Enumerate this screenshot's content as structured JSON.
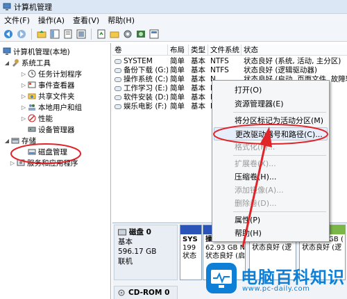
{
  "window": {
    "title": "计算机管理"
  },
  "menu": [
    "文件(F)",
    "操作(A)",
    "查看(V)",
    "帮助(H)"
  ],
  "toolbar": {
    "icons": [
      "back-arrow-icon",
      "forward-arrow-icon",
      "up-folder-icon",
      "show-tree-icon",
      "help-icon",
      "properties-icon",
      "refresh-icon",
      "open-folder-icon",
      "help-book-icon",
      "zoom-icon",
      "settings-icon"
    ]
  },
  "tree": {
    "root": "计算机管理(本地)",
    "system_tools": "系统工具",
    "task_scheduler": "任务计划程序",
    "event_viewer": "事件查看器",
    "shared_folders": "共享文件夹",
    "local_users": "本地用户和组",
    "performance": "性能",
    "device_manager": "设备管理器",
    "storage": "存储",
    "disk_management": "磁盘管理",
    "services_apps": "服务和应用程序"
  },
  "list": {
    "headers": [
      "卷",
      "布局",
      "类型",
      "文件系统",
      "状态"
    ],
    "rows": [
      [
        "SYSTEM",
        "简单",
        "基本",
        "NTFS",
        "状态良好 (系统, 活动, 主分区)"
      ],
      [
        "备份下载 (G:)",
        "简单",
        "基本",
        "NTFS",
        "状态良好 (逻辑驱动器)"
      ],
      [
        "操作系统 (C:)",
        "简单",
        "基本",
        "N",
        "状态良好 (启动, 页面文件, 故障转储"
      ],
      [
        "工作学习 (E:)",
        "简单",
        "基本",
        "N",
        ""
      ],
      [
        "软件安装 (D:)",
        "简单",
        "基本",
        "N",
        ""
      ],
      [
        "娱乐电影 (F:)",
        "简单",
        "基本",
        "N",
        ""
      ]
    ]
  },
  "context_menu": {
    "open": "打开(O)",
    "explorer": "资源管理器(E)",
    "mark_active": "将分区标记为活动分区(M)",
    "change_letter": "更改驱动器号和路径(C)...",
    "format": "格式化(F)...",
    "extend": "扩展卷(X)...",
    "shrink": "压缩卷(H)...",
    "mirror": "添加镜像(A)...",
    "delete": "删除卷(D)...",
    "properties": "属性(P)",
    "help": "帮助(H)"
  },
  "disk0": {
    "name": "磁盘 0",
    "type": "基本",
    "size": "596.17 GB",
    "status": "联机",
    "partitions": [
      {
        "name": "SYS",
        "size": "199",
        "status": "状态"
      },
      {
        "name": "操作系",
        "size": "62.93 GB N",
        "status": "状态良好 (启"
      },
      {
        "name": "",
        "size": "120.00 GB (",
        "status": "状态良好 (逻"
      },
      {
        "name": "",
        "size": "200.00 GB (",
        "status": "状态良好 (逻"
      }
    ]
  },
  "cdrom": {
    "name": "CD-ROM 0"
  },
  "watermark": {
    "text": "电脑百科知识",
    "url": "www.pc-daily.com"
  },
  "colors": {
    "highlight_oval": "#e0242a",
    "brand": "#0d7fd6",
    "bar_blue": "#2a54b8",
    "bar_green": "#7ab648"
  }
}
